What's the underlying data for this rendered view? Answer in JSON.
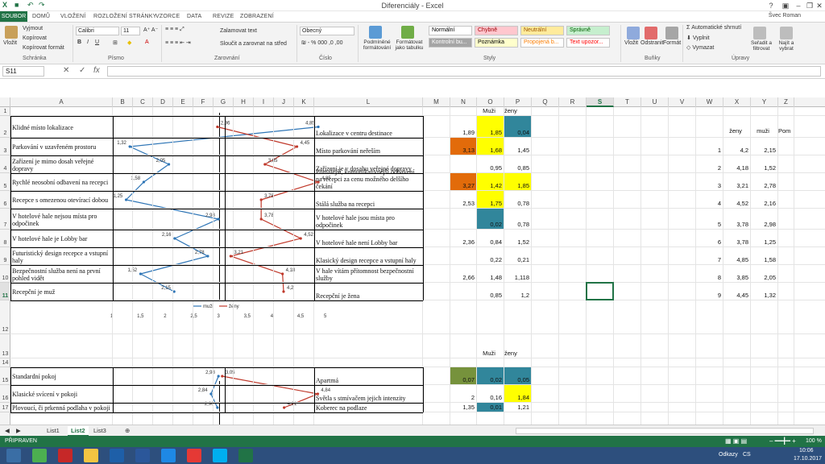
{
  "window": {
    "title": "Diferenciály - Excel",
    "user": "Švec Roman"
  },
  "tabs": [
    "SOUBOR",
    "DOMŮ",
    "VLOŽENÍ",
    "ROZLOŽENÍ STRÁNKY",
    "VZORCE",
    "DATA",
    "REVIZE",
    "ZOBRAZENÍ"
  ],
  "ribbon": {
    "clipboard": {
      "paste": "Vložit",
      "cut": "Vyjmout",
      "copy": "Kopírovat",
      "format_painter": "Kopírovat formát",
      "label": "Schránka"
    },
    "font": {
      "name": "Calibri",
      "size": "11",
      "label": "Písmo"
    },
    "alignment": {
      "wrap": "Zalamovat text",
      "merge": "Sloučit a zarovnat na střed",
      "label": "Zarovnání"
    },
    "number": {
      "format": "Obecný",
      "label": "Číslo"
    },
    "styles": {
      "cond": "Podmíněné formátování",
      "table": "Formátovat jako tabulku",
      "cells": [
        {
          "text": "Normální",
          "bg": "#ffffff",
          "color": "#000000"
        },
        {
          "text": "Chybně",
          "bg": "#ffc7ce",
          "color": "#9c0006"
        },
        {
          "text": "Neutrální",
          "bg": "#ffeb9c",
          "color": "#9c5700"
        },
        {
          "text": "Správně",
          "bg": "#c6efce",
          "color": "#006100"
        },
        {
          "text": "Kontrolní bu...",
          "bg": "#a5a5a5",
          "color": "#ffffff"
        },
        {
          "text": "Poznámka",
          "bg": "#ffffcc",
          "color": "#000000"
        },
        {
          "text": "Propojená b...",
          "bg": "#ffffff",
          "color": "#fa7d00"
        },
        {
          "text": "Text upozor...",
          "bg": "#ffffff",
          "color": "#ff0000"
        }
      ],
      "label": "Styly"
    },
    "cells": {
      "insert": "Vložit",
      "delete": "Odstranit",
      "format": "Formát",
      "label": "Buňky"
    },
    "editing": {
      "autosum": "Automatické shrnutí",
      "fill": "Vyplnit",
      "clear": "Vymazat",
      "sort": "Seřadit a filtrovat",
      "find": "Najít a vybrat",
      "label": "Úpravy"
    }
  },
  "formula_bar": {
    "name_box": "S11",
    "value": ""
  },
  "columns": [
    "A",
    "B",
    "C",
    "D",
    "E",
    "F",
    "G",
    "H",
    "I",
    "J",
    "K",
    "L",
    "M",
    "N",
    "O",
    "P",
    "Q",
    "R",
    "S",
    "T",
    "U",
    "V",
    "W",
    "X",
    "Y",
    "Z"
  ],
  "rows": [
    "1",
    "2",
    "3",
    "4",
    "5",
    "6",
    "7",
    "8",
    "9",
    "10",
    "11",
    "12",
    "13",
    "14",
    "15",
    "16",
    "17"
  ],
  "headers": {
    "muzi": "Muži",
    "zeny": "ženy",
    "zeny2": "ženy",
    "muzi2": "muži",
    "pom": "Pom"
  },
  "left_labels": [
    "Klidné místo lokalizace",
    "Parkování v uzavřeném prostoru",
    "Zařízení je mimo dosah veřejné dopravy",
    "Rychlé neosobní odbavení na recepci",
    "Recepce s omezenou otevírací dobou",
    "V hotelové hale nejsou místa pro odpočinek",
    "V hotelové hale je Lobby bar",
    "Futuristický design recepce a vstupní haly",
    "Bezpečnostní služba není na první pohled vidět",
    "Recepční je muž"
  ],
  "right_labels": [
    "Lokalizace v centru destinace",
    "Místo parkování neřeším",
    "Zařízení je v dosahu veřejné dopravy",
    "Pomalejší, komunikativnější odbavení na recepci za cenu možného delšího čekání",
    "Stálá služba na recepci",
    "V hotelové hale jsou místa pro odpočinek",
    "V hotelové hale není Lobby bar",
    "Klasický design recepce a vstupní haly",
    "V hale vítám přítomnost bezpečnostní služby",
    "Recepční je žena"
  ],
  "n_vals": [
    "1,89",
    "3,13",
    "",
    "3,27",
    "2,53",
    "",
    "2,36",
    "",
    "2,66",
    ""
  ],
  "o_vals": [
    "1,85",
    "1,68",
    "0,95",
    "1,42",
    "1,75",
    "0,02",
    "0,84",
    "0,22",
    "1,48",
    "0,85"
  ],
  "p_vals": [
    "0,04",
    "1,45",
    "0,85",
    "1,85",
    "0,78",
    "0,78",
    "1,52",
    "0,21",
    "1,118",
    "1,2"
  ],
  "w_vals": [
    "1",
    "2",
    "3",
    "4",
    "5",
    "6",
    "7",
    "8",
    "9"
  ],
  "x_vals": [
    "4,2",
    "4,18",
    "3,21",
    "4,52",
    "3,78",
    "3,78",
    "4,85",
    "3,85",
    "4,45"
  ],
  "y_vals": [
    "2,15",
    "1,52",
    "2,78",
    "2,16",
    "2,98",
    "1,25",
    "1,58",
    "2,05",
    "1,32"
  ],
  "bottom_left_labels": [
    "Standardní pokoj",
    "Klasické svícení v pokoji",
    "Plovoucí, či prkenná podlaha v pokoji"
  ],
  "bottom_right_labels": [
    "Apartmá",
    "Světla s stmívačem jejich intenzity",
    "Koberec na podlaze"
  ],
  "bottom_n": [
    "0,07",
    "2",
    "1,35"
  ],
  "bottom_o": [
    "0,02",
    "0,16",
    "0,01"
  ],
  "bottom_p": [
    "0,05",
    "1,84",
    "1,21"
  ],
  "chart_data": [
    {
      "type": "line",
      "orientation": "horizontal",
      "x_ticks": [
        "1",
        "1,5",
        "2",
        "2,5",
        "3",
        "3,5",
        "4",
        "4,5",
        "5"
      ],
      "xlim": [
        1,
        5
      ],
      "series": [
        {
          "name": "muži",
          "color": "#2e75b6",
          "values": [
            4.85,
            1.32,
            2.05,
            1.58,
            1.25,
            2.98,
            2.16,
            2.78,
            1.52,
            2.15
          ]
        },
        {
          "name": "ženy",
          "color": "#c0392b",
          "values": [
            2.96,
            4.45,
            3.85,
            4.85,
            3.78,
            3.78,
            4.52,
            3.21,
            4.18,
            4.2
          ]
        }
      ]
    },
    {
      "type": "line",
      "orientation": "horizontal",
      "xlim": [
        1,
        5
      ],
      "series": [
        {
          "name": "muži",
          "color": "#2e75b6",
          "values": [
            2.98,
            2.84,
            2.96
          ]
        },
        {
          "name": "ženy",
          "color": "#c0392b",
          "values": [
            3.05,
            4.84,
            4.21
          ]
        }
      ]
    }
  ],
  "sheets": [
    "List1",
    "List2",
    "List3"
  ],
  "status": {
    "ready": "PŘIPRAVEN",
    "zoom": "100 %"
  },
  "taskbar": {
    "lang": "CS",
    "links": "Odkazy",
    "time": "10:06",
    "date": "17.10.2017"
  }
}
